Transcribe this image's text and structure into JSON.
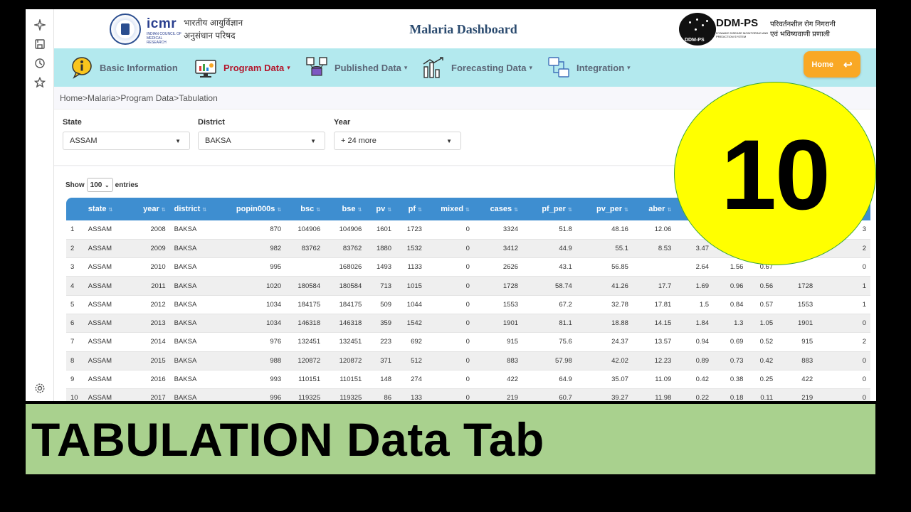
{
  "header": {
    "title": "Malaria Dashboard",
    "icmr": {
      "word": "icmr",
      "sub": "INDIAN COUNCIL OF MEDICAL RESEARCH",
      "hindi_line1": "भारतीय आयुर्विज्ञान",
      "hindi_line2": "अनुसंधान परिषद"
    },
    "ddm": {
      "name": "DDM-PS",
      "circle_text": "DDM-PS",
      "tagline": "DYNAMIC DISEASE MONITORING AND PREDICTION SYSTEM",
      "hindi_line1": "परिवर्तनशील रोग निगरानी",
      "hindi_line2": "एवं भविष्यवाणी प्रणाली"
    }
  },
  "nav": {
    "items": [
      {
        "label": "Basic Information",
        "caret": ""
      },
      {
        "label": "Program Data",
        "caret": "▾"
      },
      {
        "label": "Published Data",
        "caret": "▾"
      },
      {
        "label": "Forecasting Data",
        "caret": "▾"
      },
      {
        "label": "Integration",
        "caret": "▾"
      }
    ],
    "home_label": "Home",
    "home_icon": "↩"
  },
  "breadcrumb": "Home>Malaria>Program Data>Tabulation",
  "filters": [
    {
      "label": "State",
      "value": "ASSAM"
    },
    {
      "label": "District",
      "value": "BAKSA"
    },
    {
      "label": "Year",
      "value": "+ 24 more"
    }
  ],
  "entries": {
    "show": "Show",
    "value": "100",
    "suffix": "entries"
  },
  "table": {
    "columns": [
      "",
      "state",
      "year",
      "district",
      "popin000s",
      "bsc",
      "bse",
      "pv",
      "pf",
      "mixed",
      "cases",
      "pf_per",
      "pv_per",
      "aber",
      "",
      "",
      "",
      "",
      ""
    ],
    "rows": [
      [
        "1",
        "ASSAM",
        "2008",
        "BAKSA",
        "870",
        "104906",
        "104906",
        "1601",
        "1723",
        "0",
        "3324",
        "51.8",
        "48.16",
        "12.06",
        "",
        "",
        "",
        "",
        "3"
      ],
      [
        "2",
        "ASSAM",
        "2009",
        "BAKSA",
        "982",
        "83762",
        "83762",
        "1880",
        "1532",
        "0",
        "3412",
        "44.9",
        "55.1",
        "8.53",
        "3.47",
        "",
        "",
        "",
        "2"
      ],
      [
        "3",
        "ASSAM",
        "2010",
        "BAKSA",
        "995",
        "",
        "168026",
        "1493",
        "1133",
        "0",
        "2626",
        "43.1",
        "56.85",
        "",
        "2.64",
        "1.56",
        "0.67",
        "",
        "0"
      ],
      [
        "4",
        "ASSAM",
        "2011",
        "BAKSA",
        "1020",
        "180584",
        "180584",
        "713",
        "1015",
        "0",
        "1728",
        "58.74",
        "41.26",
        "17.7",
        "1.69",
        "0.96",
        "0.56",
        "1728",
        "1"
      ],
      [
        "5",
        "ASSAM",
        "2012",
        "BAKSA",
        "1034",
        "184175",
        "184175",
        "509",
        "1044",
        "0",
        "1553",
        "67.2",
        "32.78",
        "17.81",
        "1.5",
        "0.84",
        "0.57",
        "1553",
        "1"
      ],
      [
        "6",
        "ASSAM",
        "2013",
        "BAKSA",
        "1034",
        "146318",
        "146318",
        "359",
        "1542",
        "0",
        "1901",
        "81.1",
        "18.88",
        "14.15",
        "1.84",
        "1.3",
        "1.05",
        "1901",
        "0"
      ],
      [
        "7",
        "ASSAM",
        "2014",
        "BAKSA",
        "976",
        "132451",
        "132451",
        "223",
        "692",
        "0",
        "915",
        "75.6",
        "24.37",
        "13.57",
        "0.94",
        "0.69",
        "0.52",
        "915",
        "2"
      ],
      [
        "8",
        "ASSAM",
        "2015",
        "BAKSA",
        "988",
        "120872",
        "120872",
        "371",
        "512",
        "0",
        "883",
        "57.98",
        "42.02",
        "12.23",
        "0.89",
        "0.73",
        "0.42",
        "883",
        "0"
      ],
      [
        "9",
        "ASSAM",
        "2016",
        "BAKSA",
        "993",
        "110151",
        "110151",
        "148",
        "274",
        "0",
        "422",
        "64.9",
        "35.07",
        "11.09",
        "0.42",
        "0.38",
        "0.25",
        "422",
        "0"
      ],
      [
        "10",
        "ASSAM",
        "2017",
        "BAKSA",
        "996",
        "119325",
        "119325",
        "86",
        "133",
        "0",
        "219",
        "60.7",
        "39.27",
        "11.98",
        "0.22",
        "0.18",
        "0.11",
        "219",
        "0"
      ]
    ]
  },
  "badge": "10",
  "banner": "TABULATION Data Tab",
  "colors": {
    "nav_bg": "#b3e9ee",
    "table_header": "#3e8ed0",
    "home_button": "#f9a825",
    "active_nav": "#b3162c",
    "badge": "#ffff00",
    "banner": "#a9d18e"
  }
}
